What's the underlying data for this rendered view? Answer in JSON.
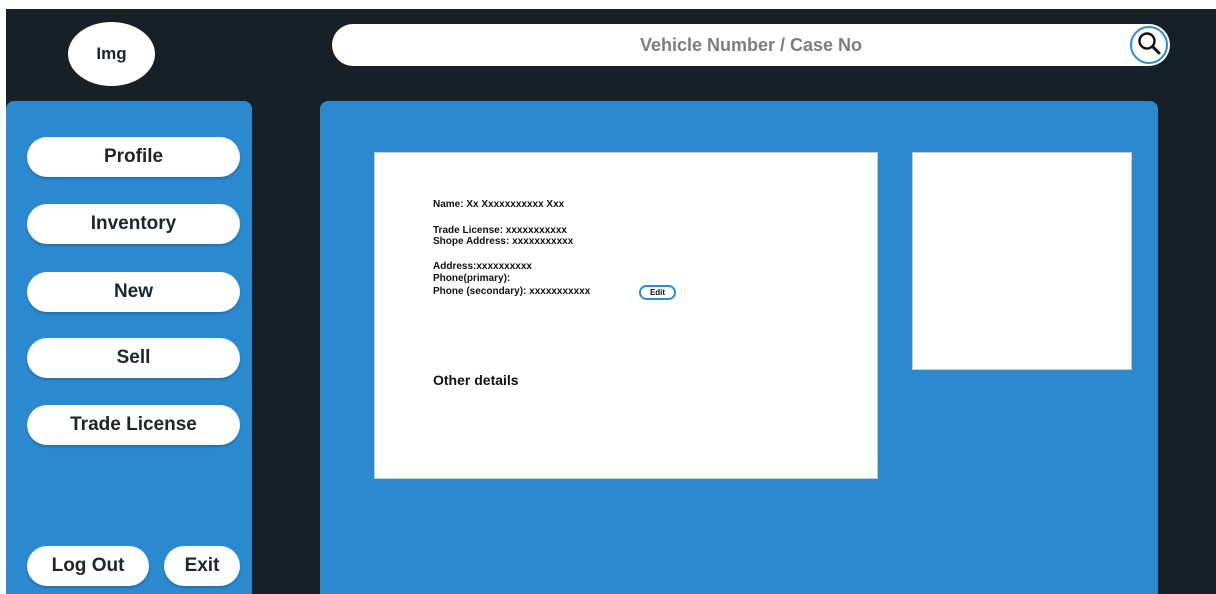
{
  "header": {
    "avatar_label": "Img",
    "search": {
      "placeholder": "Vehicle Number / Case No",
      "button_icon": "search-icon"
    }
  },
  "sidebar": {
    "items": [
      {
        "label": "Profile"
      },
      {
        "label": "Inventory"
      },
      {
        "label": "New"
      },
      {
        "label": "Sell"
      },
      {
        "label": "Trade License"
      }
    ],
    "logout_label": "Log Out",
    "exit_label": "Exit"
  },
  "profile": {
    "name": "Name: Xx Xxxxxxxxxxx Xxx",
    "trade_license": "Trade License: xxxxxxxxxxx",
    "shop_address": "Shope Address: xxxxxxxxxxx",
    "address": "Address:xxxxxxxxxx",
    "phone_primary": "Phone(primary):",
    "phone_secondary": "Phone (secondary): xxxxxxxxxxx",
    "edit_label": "Edit",
    "other_details": "Other details"
  },
  "colors": {
    "frame": "#172027",
    "panel": "#2a89cf",
    "accent": "#2d8bd0",
    "card": "#ffffff"
  }
}
